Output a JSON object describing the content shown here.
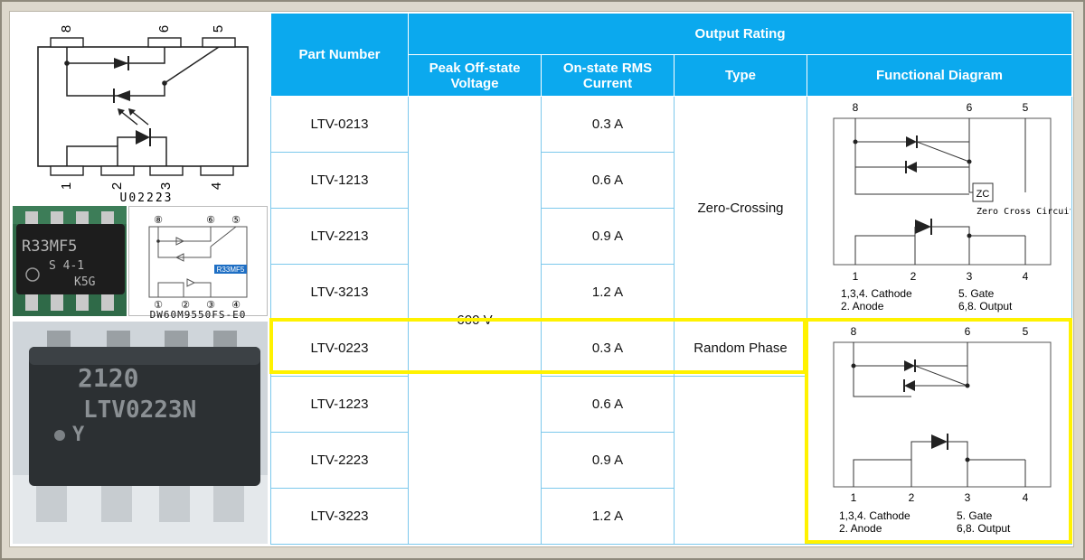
{
  "left": {
    "top_schematic": {
      "pins_top": [
        "8",
        "6",
        "5"
      ],
      "pins_bottom": [
        "1",
        "2",
        "3",
        "4"
      ],
      "caption": "U02223"
    },
    "chip_photo_small": {
      "marking_line1": "R33MF5",
      "marking_line2": "S 4-1",
      "marking_line3": "K5G"
    },
    "small_diagram": {
      "pins_top": [
        "⑧",
        "⑥",
        "⑤"
      ],
      "pins_bottom": [
        "①",
        "②",
        "③",
        "④"
      ],
      "tag": "R33MF5",
      "caption": "DW60M9550FS-E0"
    },
    "chip_photo_large": {
      "marking_line1": "2120",
      "marking_line2": "LTV0223N",
      "marking_line3": "Y"
    }
  },
  "table": {
    "header": {
      "part_number": "Part Number",
      "output_rating": "Output Rating",
      "peak_voltage": "Peak Off-state Voltage",
      "rms_current": "On-state RMS Current",
      "type": "Type",
      "functional_diagram": "Functional Diagram"
    },
    "rows": [
      {
        "part": "LTV-0213",
        "current": "0.3 A"
      },
      {
        "part": "LTV-1213",
        "current": "0.6 A"
      },
      {
        "part": "LTV-2213",
        "current": "0.9 A"
      },
      {
        "part": "LTV-3213",
        "current": "1.2 A"
      },
      {
        "part": "LTV-0223",
        "current": "0.3 A"
      },
      {
        "part": "LTV-1223",
        "current": "0.6 A"
      },
      {
        "part": "LTV-2223",
        "current": "0.9 A"
      },
      {
        "part": "LTV-3223",
        "current": "1.2 A"
      }
    ],
    "voltage": "600 V",
    "type_zero": "Zero-Crossing",
    "type_random": "Random Phase",
    "diagram_zero": {
      "pins_top": [
        "8",
        "6",
        "5"
      ],
      "pins_bottom": [
        "1",
        "2",
        "3",
        "4"
      ],
      "zc": "ZC",
      "zc_label": "Zero Cross Circuit",
      "legend_1": "1,3,4.  Cathode",
      "legend_2": "2.  Anode",
      "legend_3": "5.  Gate",
      "legend_4": "6,8.  Output"
    },
    "diagram_random": {
      "pins_top": [
        "8",
        "6",
        "5"
      ],
      "pins_bottom": [
        "1",
        "2",
        "3",
        "4"
      ],
      "legend_1": "1,3,4.  Cathode",
      "legend_2": "2.  Anode",
      "legend_3": "5.  Gate",
      "legend_4": "6,8.  Output"
    }
  },
  "colors": {
    "header_blue": "#0ba9ee",
    "highlight_yellow": "#fff200"
  }
}
